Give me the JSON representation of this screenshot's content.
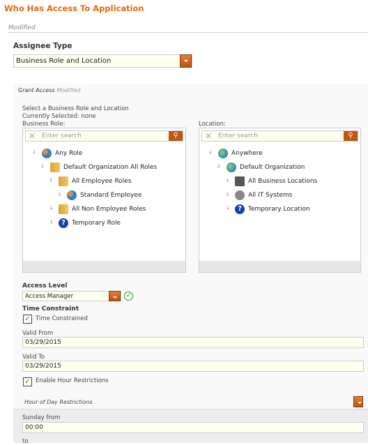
{
  "title": "Who Has Access To Application",
  "modified": "Modified",
  "assignee": {
    "label": "Assignee Type",
    "value": "Business Role and Location"
  },
  "grant": {
    "title": "Grant Access",
    "modified": "Modified",
    "instructions": "Select a Business Role and Location",
    "current": "Currently Selected: none",
    "role_label": "Business Role:",
    "location_label": "Location:",
    "search_placeholder": "Enter search",
    "roles": [
      {
        "label": "Any Role",
        "icon": "people-icon"
      },
      {
        "label": "Default Organization All Roles",
        "icon": "folder-icon"
      },
      {
        "label": "All Employee Roles",
        "icon": "folder-icon"
      },
      {
        "label": "Standard Employee",
        "icon": "people-icon"
      },
      {
        "label": "All Non Employee Roles",
        "icon": "folder-icon"
      },
      {
        "label": "Temporary Role",
        "icon": "question-icon"
      }
    ],
    "locations": [
      {
        "label": "Anywhere",
        "icon": "globe-icon"
      },
      {
        "label": "Default Organization",
        "icon": "globe-icon"
      },
      {
        "label": "All Business Locations",
        "icon": "building-icon"
      },
      {
        "label": "All IT Systems",
        "icon": "gear-icon"
      },
      {
        "label": "Temporary Location",
        "icon": "question-icon"
      }
    ]
  },
  "access_level": {
    "label": "Access Level",
    "value": "Access Manager"
  },
  "time": {
    "label": "Time Constraint",
    "constrained_label": "Time Constrained",
    "constrained": true,
    "valid_from_label": "Valid From",
    "valid_from": "03/29/2015",
    "valid_to_label": "Valid To",
    "valid_to": "03/29/2015",
    "hour_label": "Enable Hour Restrictions",
    "hour_enabled": true
  },
  "hours": {
    "title": "Hour of Day Restrictions",
    "sunday_from_label": "Sunday from",
    "sunday_from": "00:00",
    "to_label": "to"
  },
  "colors": {
    "accent": "#e06a10",
    "button": "#c0560f",
    "check": "#1a9a1a"
  }
}
